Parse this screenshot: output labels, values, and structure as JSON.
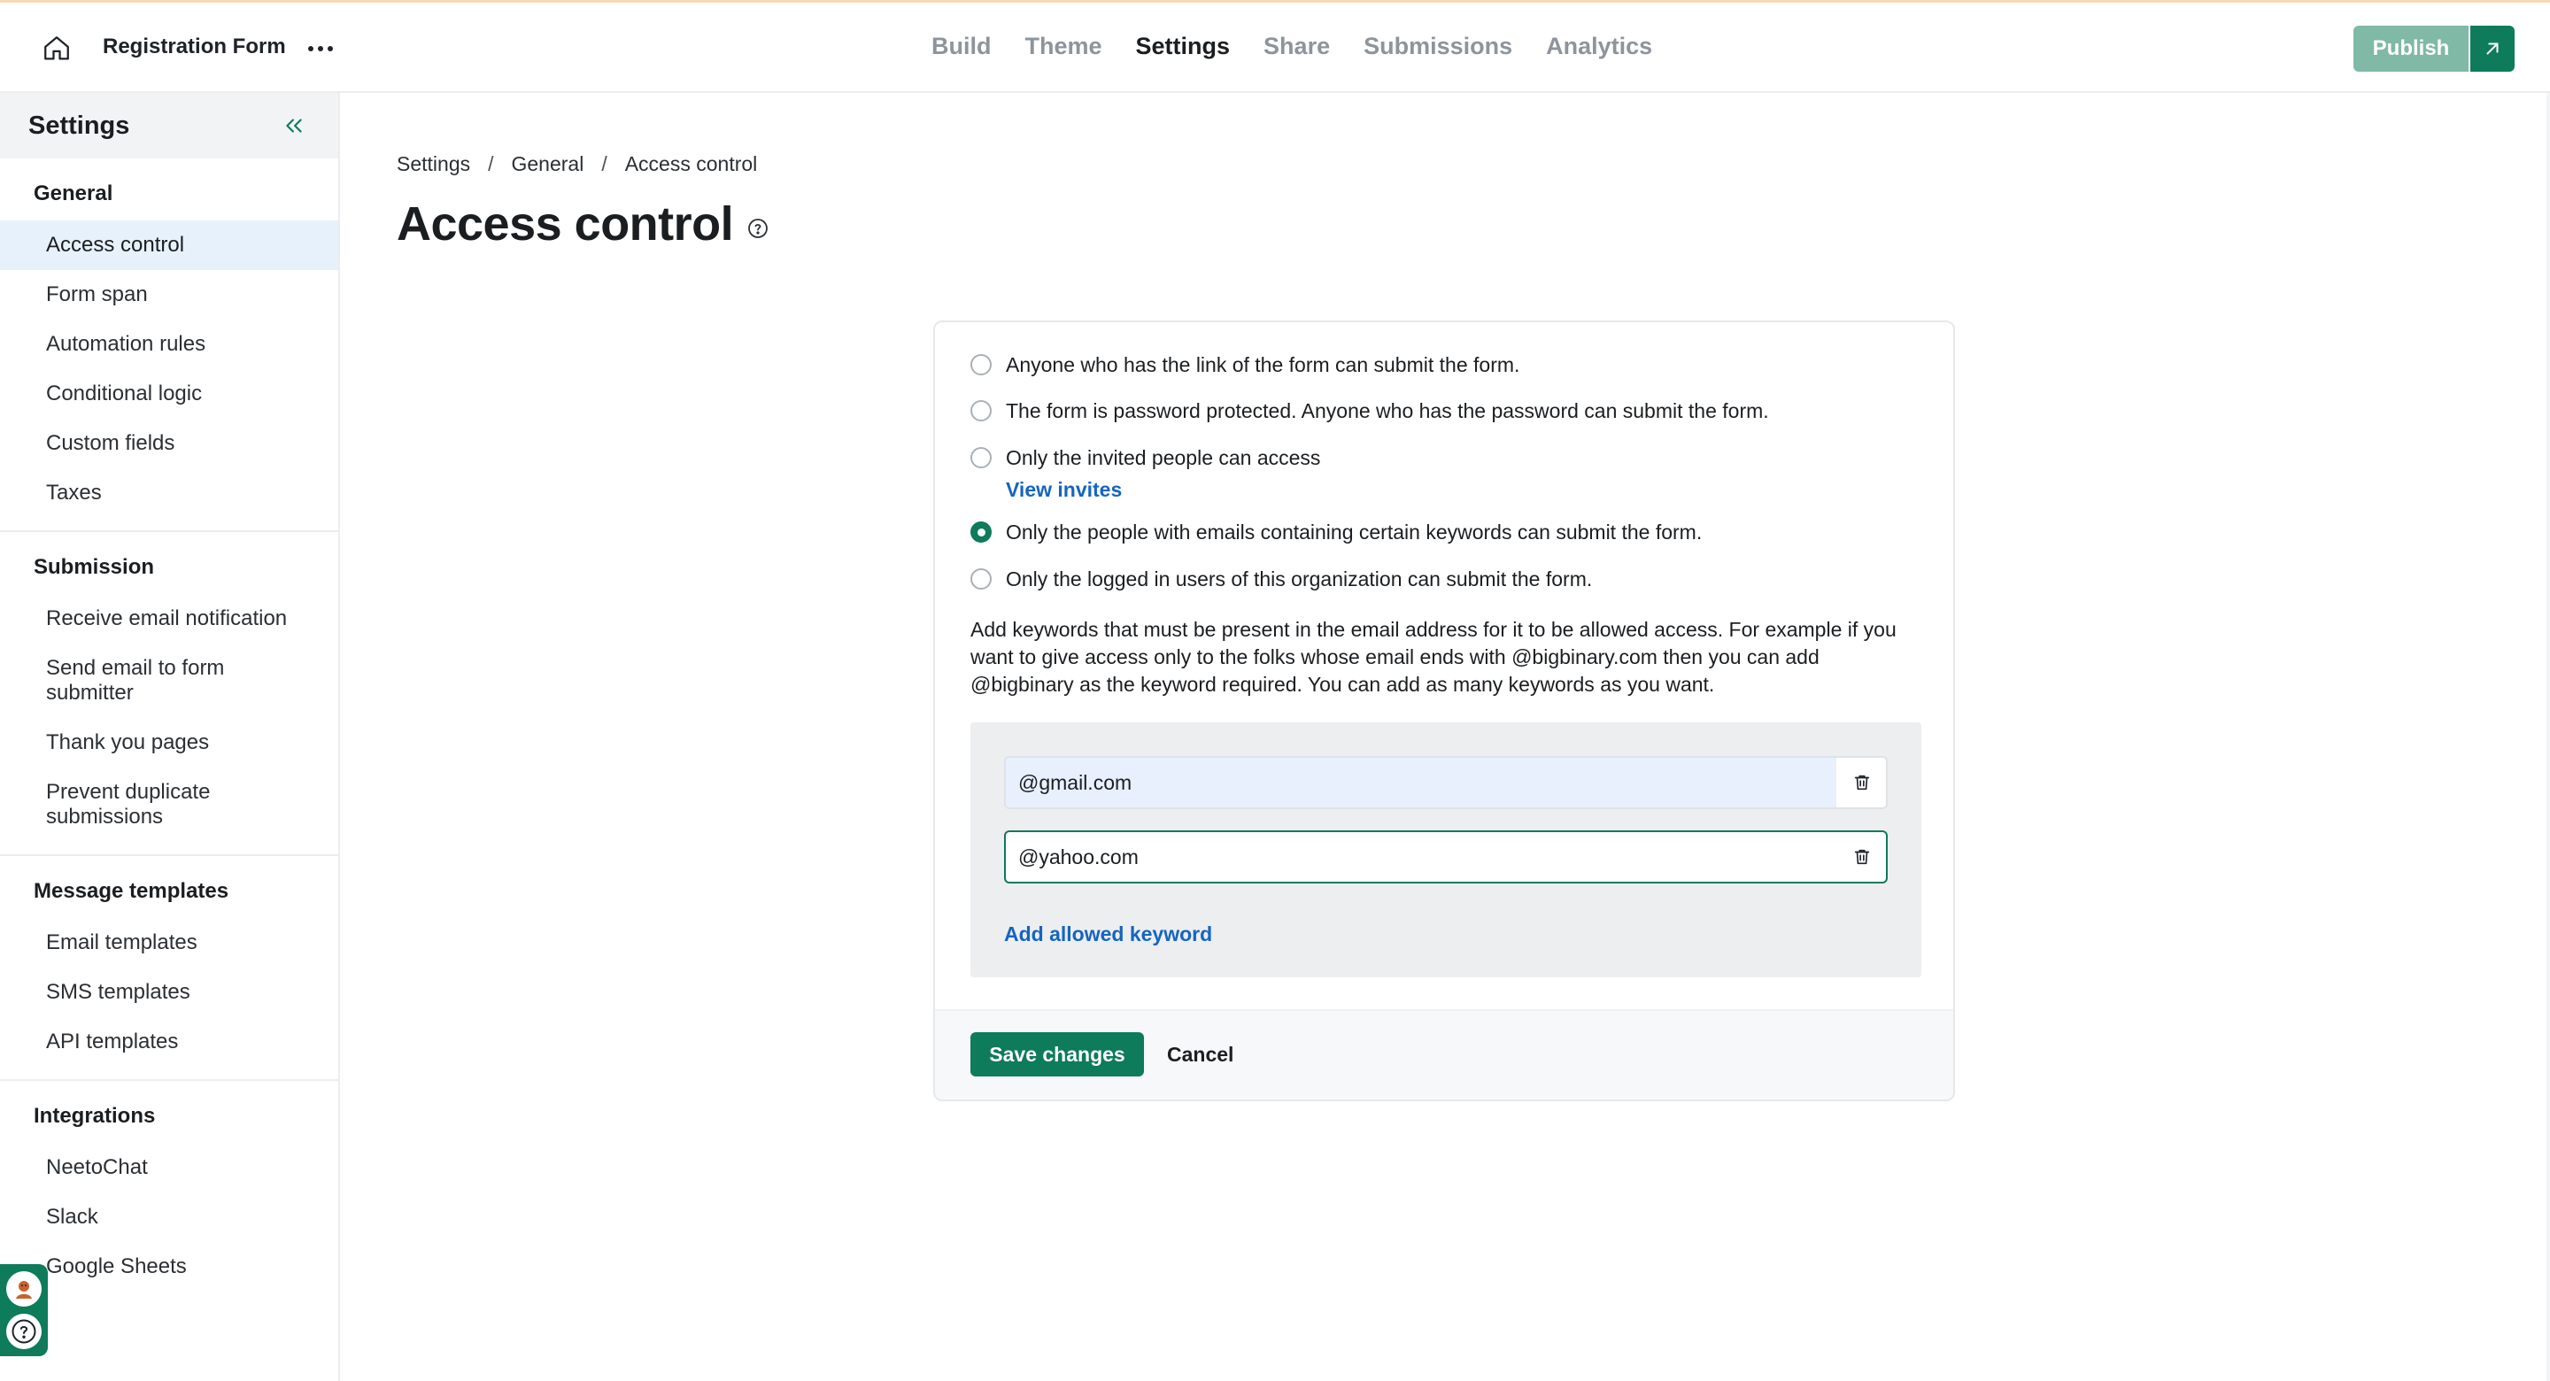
{
  "app": {
    "title": "Registration Form"
  },
  "header": {
    "tabs": [
      {
        "label": "Build",
        "active": false
      },
      {
        "label": "Theme",
        "active": false
      },
      {
        "label": "Settings",
        "active": true
      },
      {
        "label": "Share",
        "active": false
      },
      {
        "label": "Submissions",
        "active": false
      },
      {
        "label": "Analytics",
        "active": false
      }
    ],
    "publish_label": "Publish",
    "icons": {
      "home": "home-icon",
      "more": "more-horizontal-icon",
      "open_external": "arrow-up-right-icon"
    }
  },
  "sidebar": {
    "title": "Settings",
    "collapse_icon": "double-chevron-left-icon",
    "groups": [
      {
        "title": "General",
        "items": [
          {
            "label": "Access control",
            "active": true
          },
          {
            "label": "Form span"
          },
          {
            "label": "Automation rules"
          },
          {
            "label": "Conditional logic"
          },
          {
            "label": "Custom fields"
          },
          {
            "label": "Taxes"
          }
        ]
      },
      {
        "title": "Submission",
        "items": [
          {
            "label": "Receive email notification"
          },
          {
            "label": "Send email to form submitter"
          },
          {
            "label": "Thank you pages"
          },
          {
            "label": "Prevent duplicate submissions"
          }
        ]
      },
      {
        "title": "Message templates",
        "items": [
          {
            "label": "Email templates"
          },
          {
            "label": "SMS templates"
          },
          {
            "label": "API templates"
          }
        ]
      },
      {
        "title": "Integrations",
        "items": [
          {
            "label": "NeetoChat"
          },
          {
            "label": "Slack"
          },
          {
            "label": "Google Sheets"
          }
        ]
      }
    ]
  },
  "floating_widgets": {
    "chat_icon": "chat-avatar-icon",
    "help_icon": "help-circle-icon"
  },
  "breadcrumb": [
    "Settings",
    "General",
    "Access control"
  ],
  "page": {
    "title": "Access control",
    "help_icon": "help-circle-icon"
  },
  "access": {
    "options": [
      {
        "label": "Anyone who has the link of the form can submit the form.",
        "checked": false
      },
      {
        "label": "The form is password protected. Anyone who has the password can submit the form.",
        "checked": false
      },
      {
        "label": "Only the invited people can access",
        "checked": false,
        "link": "View invites"
      },
      {
        "label": "Only the people with emails containing certain keywords can submit the form.",
        "checked": true
      },
      {
        "label": "Only the logged in users of this organization can submit the form.",
        "checked": false
      }
    ],
    "description": "Add keywords that must be present in the email address for it to be allowed access. For example if you want to give access only to the folks whose email ends with @bigbinary.com then you can add @bigbinary as the keyword required. You can add as many keywords as you want.",
    "keywords": [
      "@gmail.com",
      "@yahoo.com"
    ],
    "delete_icon": "trash-icon",
    "add_keyword_label": "Add allowed keyword"
  },
  "footer": {
    "save_label": "Save changes",
    "cancel_label": "Cancel"
  },
  "colors": {
    "primary": "#0e7b5b",
    "publish_disabled": "#80b9a6",
    "link": "#1565c0",
    "active_sidebar_bg": "#e6f1fc"
  }
}
